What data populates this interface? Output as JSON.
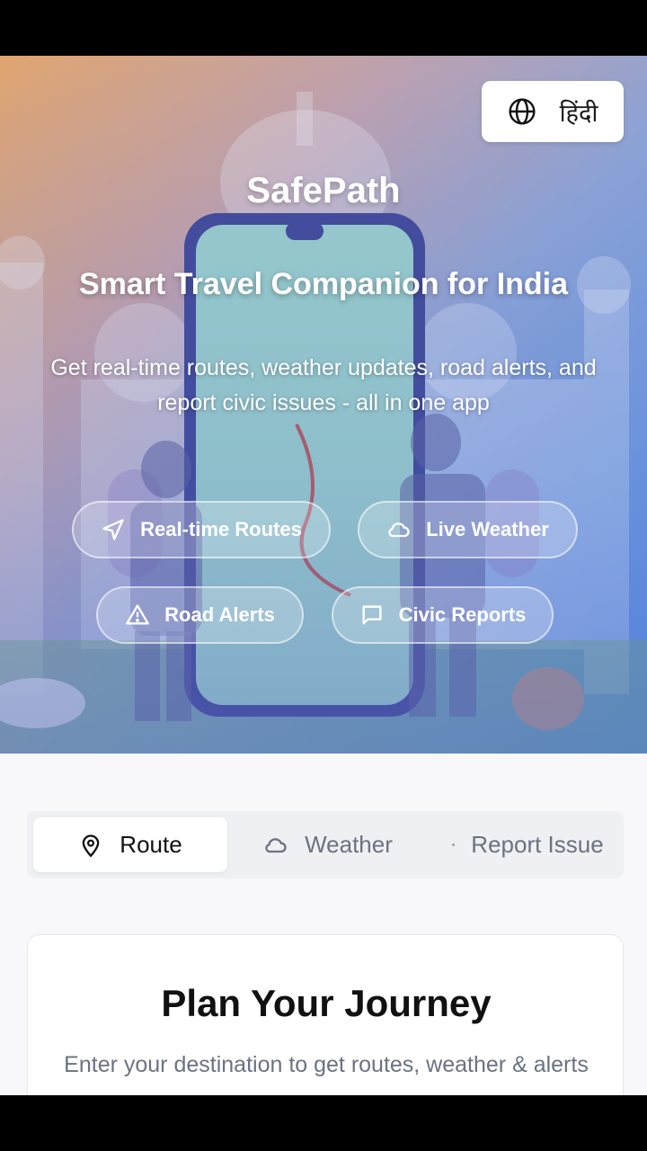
{
  "language": {
    "label": "हिंदी",
    "icon": "globe-icon"
  },
  "hero": {
    "brand": "SafePath",
    "tagline": "Smart Travel Companion for India",
    "description": "Get real-time routes, weather updates, road alerts, and report civic issues - all in one app",
    "features": [
      {
        "label": "Real-time Routes",
        "icon": "navigation-arrow-icon"
      },
      {
        "label": "Live Weather",
        "icon": "cloud-icon"
      },
      {
        "label": "Road Alerts",
        "icon": "warning-triangle-icon"
      },
      {
        "label": "Civic Reports",
        "icon": "message-square-icon"
      }
    ]
  },
  "tabs": [
    {
      "label": "Route",
      "icon": "map-pin-icon",
      "active": true
    },
    {
      "label": "Weather",
      "icon": "cloud-icon",
      "active": false
    },
    {
      "label": "Report Issue",
      "icon": "dot-icon",
      "active": false
    }
  ],
  "journey": {
    "title": "Plan Your Journey",
    "subtitle": "Enter your destination to get routes, weather & alerts"
  },
  "colors": {
    "accent": "#4f8fe8",
    "hero_warm": "#f3a85d",
    "text_muted": "#6b7282"
  }
}
